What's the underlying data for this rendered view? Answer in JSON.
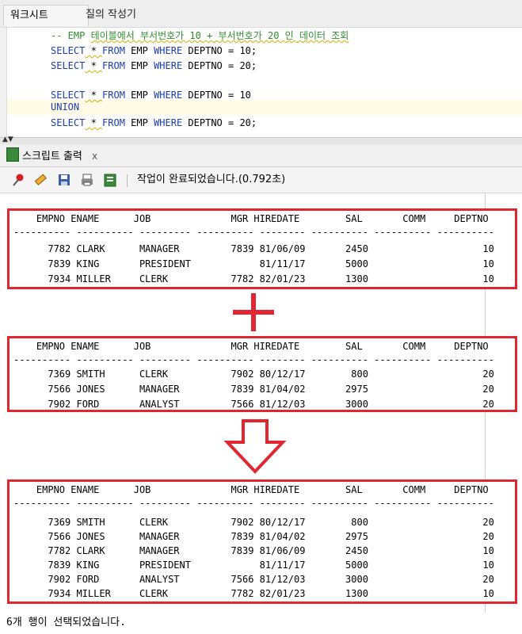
{
  "tabs": {
    "worksheet": "워크시트",
    "query_builder": "질의 작성기"
  },
  "editor": {
    "comment_prefix": "-- EMP ",
    "comment_body": "테이블에서 부서번호가 10 + 부서번호가 20 인 데이터 조회",
    "lines": [
      {
        "kw1": "SELECT",
        "star": " * ",
        "kw2": "FROM",
        "mid": " EMP ",
        "kw3": "WHERE",
        "tail": " DEPTNO = 10;"
      },
      {
        "kw1": "SELECT",
        "star": " * ",
        "kw2": "FROM",
        "mid": " EMP ",
        "kw3": "WHERE",
        "tail": " DEPTNO = 20;"
      },
      {
        "kw1": "SELECT",
        "star": " * ",
        "kw2": "FROM",
        "mid": " EMP ",
        "kw3": "WHERE",
        "tail": " DEPTNO = 10"
      },
      {
        "kw1": "UNION"
      },
      {
        "kw1": "SELECT",
        "star": " * ",
        "kw2": "FROM",
        "mid": " EMP ",
        "kw3": "WHERE",
        "tail": " DEPTNO = 20;"
      }
    ]
  },
  "output": {
    "tab_label": "스크립트 출력",
    "tab_close": "x",
    "message": "작업이 완료되었습니다.(0.792초)"
  },
  "table": {
    "header": "    EMPNO ENAME      JOB              MGR HIREDATE        SAL       COMM     DEPTNO",
    "rule": "---------- ---------- --------- ---------- -------- ---------- ---------- ----------"
  },
  "results": [
    {
      "rows": [
        "      7782 CLARK      MANAGER         7839 81/06/09       2450                    10",
        "      7839 KING       PRESIDENT            81/11/17       5000                    10",
        "      7934 MILLER     CLERK           7782 82/01/23       1300                    10"
      ]
    },
    {
      "rows": [
        "      7369 SMITH      CLERK           7902 80/12/17        800                    20",
        "      7566 JONES      MANAGER         7839 81/04/02       2975                    20",
        "      7902 FORD       ANALYST         7566 81/12/03       3000                    20"
      ]
    },
    {
      "rows": [
        "      7369 SMITH      CLERK           7902 80/12/17        800                    20",
        "      7566 JONES      MANAGER         7839 81/04/02       2975                    20",
        "      7782 CLARK      MANAGER         7839 81/06/09       2450                    10",
        "      7839 KING       PRESIDENT            81/11/17       5000                    10",
        "      7902 FORD       ANALYST         7566 81/12/03       3000                    20",
        "      7934 MILLER     CLERK           7782 82/01/23       1300                    10"
      ]
    }
  ],
  "status": "6개 행이 선택되었습니다.",
  "colors": {
    "annotation_red": "#e0262f",
    "keyword_blue": "#1a3fa8",
    "comment_green": "#2e8b2e"
  },
  "icons": [
    "pin-icon",
    "eraser-icon",
    "save-icon",
    "print-icon",
    "export-icon"
  ]
}
